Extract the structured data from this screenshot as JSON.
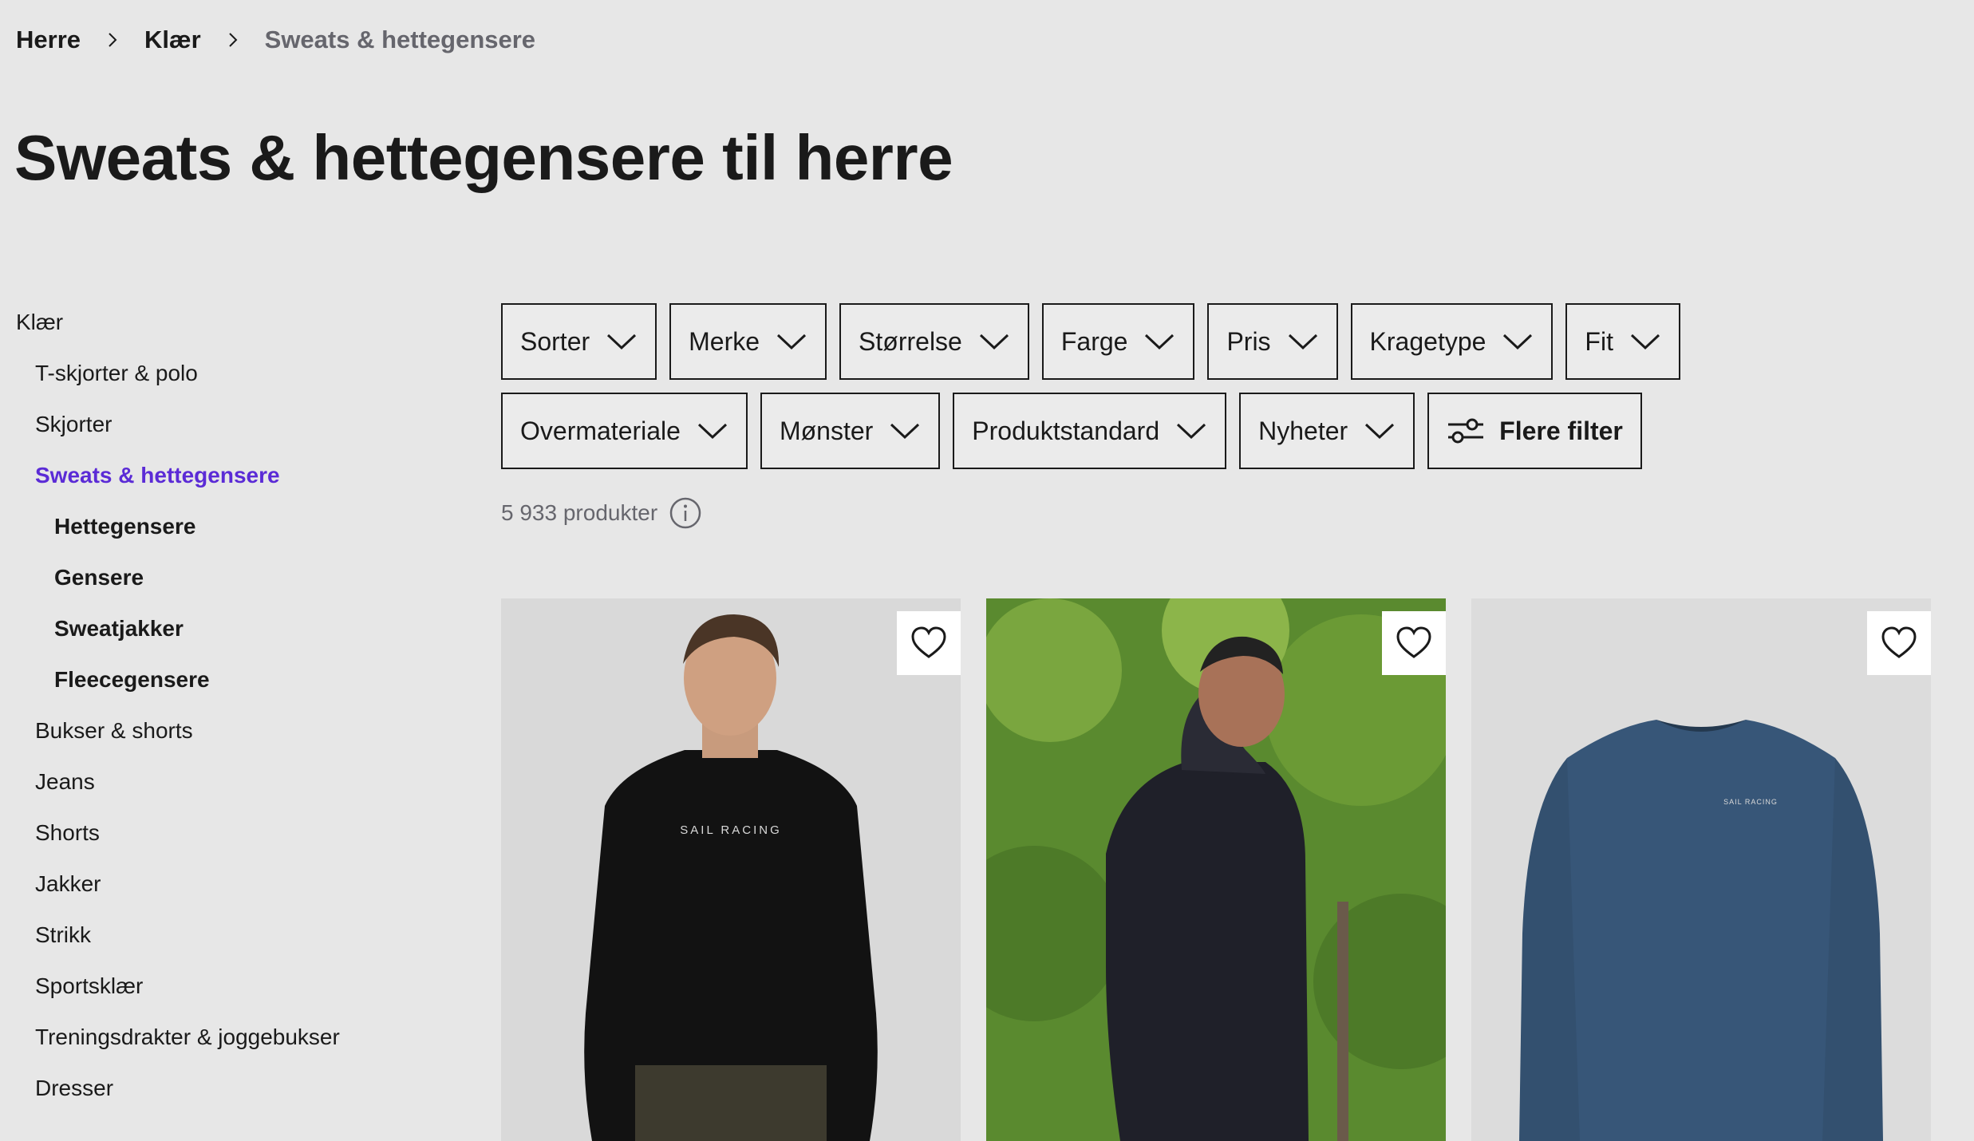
{
  "breadcrumb": [
    "Herre",
    "Klær",
    "Sweats & hettegensere"
  ],
  "page_title": "Sweats & hettegensere til herre",
  "sidebar": {
    "items": [
      {
        "label": "Klær",
        "level": 0
      },
      {
        "label": "T-skjorter & polo",
        "level": 1
      },
      {
        "label": "Skjorter",
        "level": 1
      },
      {
        "label": "Sweats & hettegensere",
        "level": 1,
        "active": true
      },
      {
        "label": "Hettegensere",
        "level": 2
      },
      {
        "label": "Gensere",
        "level": 2
      },
      {
        "label": "Sweatjakker",
        "level": 2
      },
      {
        "label": "Fleecegensere",
        "level": 2
      },
      {
        "label": "Bukser & shorts",
        "level": 1
      },
      {
        "label": "Jeans",
        "level": 1
      },
      {
        "label": "Shorts",
        "level": 1
      },
      {
        "label": "Jakker",
        "level": 1
      },
      {
        "label": "Strikk",
        "level": 1
      },
      {
        "label": "Sportsklær",
        "level": 1
      },
      {
        "label": "Treningsdrakter & joggebukser",
        "level": 1
      },
      {
        "label": "Dresser",
        "level": 1
      }
    ]
  },
  "filters": {
    "row1": [
      "Sorter",
      "Merke",
      "Størrelse",
      "Farge",
      "Pris",
      "Kragetype",
      "Fit"
    ],
    "row2": [
      "Overmateriale",
      "Mønster",
      "Produktstandard",
      "Nyheter"
    ],
    "more": "Flere filter"
  },
  "count_text": "5 933 produkter",
  "products": [
    {
      "image": "man-black-sweater",
      "brand_print": "SAIL RACING",
      "icon": "heart-icon"
    },
    {
      "image": "man-hoodie-forest",
      "icon": "heart-icon"
    },
    {
      "image": "navy-sweater",
      "brand_print": "SAIL RACING",
      "icon": "heart-icon"
    }
  ],
  "colors": {
    "accent": "#5b2bd6",
    "background": "#e7e7e7",
    "text": "#1a1a1a",
    "muted": "#66666d"
  }
}
